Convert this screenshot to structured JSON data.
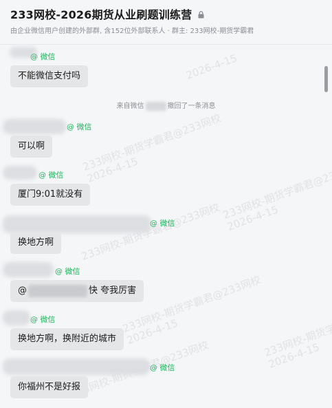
{
  "header": {
    "title": "233网校-2026期货从业刷题训练营",
    "subtitle": "由企业微信用户创建的外部群, 含152位外部联系人 · 群主: 233网校-期货学霸君"
  },
  "messages": [
    {
      "tag": "@ 微信",
      "text": "不能微信支付吗"
    },
    {
      "tag": "@ 微信",
      "text": "可以啊"
    },
    {
      "tag": "@ 微信",
      "text": "厦门9:01就没有"
    },
    {
      "tag": "@ 微信",
      "text": "换地方啊"
    },
    {
      "tag": "@ 微信",
      "text_prefix": "@",
      "text_suffix": "快 夸我厉害"
    },
    {
      "tag": "@ 微信",
      "text": "换地方啊，换附近的城市"
    },
    {
      "tag": "@ 微信",
      "text": "你福州不是好报"
    }
  ],
  "system_notice": {
    "prefix": "来自微信",
    "suffix": "撤回了一条消息"
  },
  "watermark": {
    "line1": "233网校-期货学霸君@233网校",
    "line2": "2026-4-15"
  },
  "colors": {
    "tag_green": "#22b35e",
    "bubble_bg": "#e5e6e8",
    "page_bg": "#f5f6f8"
  }
}
